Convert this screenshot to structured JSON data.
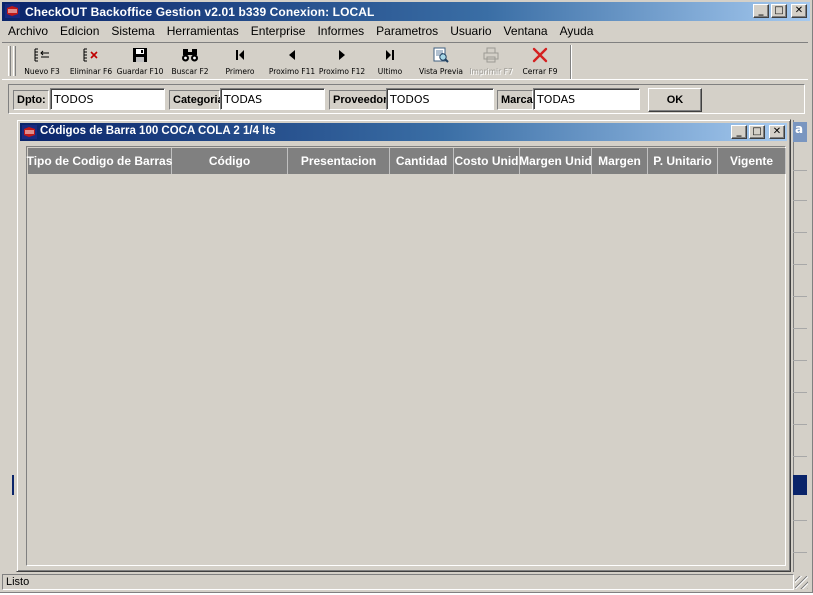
{
  "window": {
    "title": "CheckOUT Backoffice Gestion v2.01 b339 Conexion: LOCAL",
    "minimize": "_",
    "maximize": "□",
    "close": "✕"
  },
  "menu": [
    "Archivo",
    "Edicion",
    "Sistema",
    "Herramientas",
    "Enterprise",
    "Informes",
    "Parametros",
    "Usuario",
    "Ventana",
    "Ayuda"
  ],
  "toolbar": {
    "nuevo": "Nuevo F3",
    "eliminar": "Eliminar F6",
    "guardar": "Guardar F10",
    "buscar": "Buscar F2",
    "primero": "Primero",
    "proximo11": "Proximo F11",
    "proximo12": "Proximo F12",
    "ultimo": "Ultimo",
    "vista": "Vista Previa",
    "imprimir": "Imprimir F7",
    "cerrar": "Cerrar F9"
  },
  "filters": {
    "dpto_label": "Dpto:",
    "dpto_value": "TODOS",
    "categoria_label": "Categoria:",
    "categoria_value": "TODAS",
    "proveedor_label": "Proveedor:",
    "proveedor_value": "TODOS",
    "marca_label": "Marca:",
    "marca_value": "TODAS",
    "ok": "OK"
  },
  "child_window": {
    "title": "Códigos de Barra 100 COCA COLA 2 1/4 lts",
    "columns": [
      "Tipo de Codigo de Barras",
      "Código",
      "Presentacion",
      "Cantidad",
      "Costo Unid",
      "Margen Unid",
      "Margen",
      "P. Unitario",
      "Vigente"
    ]
  },
  "mdi_behind_title_fragment": "a",
  "status": {
    "text": "Listo"
  },
  "colors": {
    "titlebar": "#0a246a",
    "face": "#d4d0c8",
    "grid_header": "#808080",
    "close_red": "#d42020"
  }
}
